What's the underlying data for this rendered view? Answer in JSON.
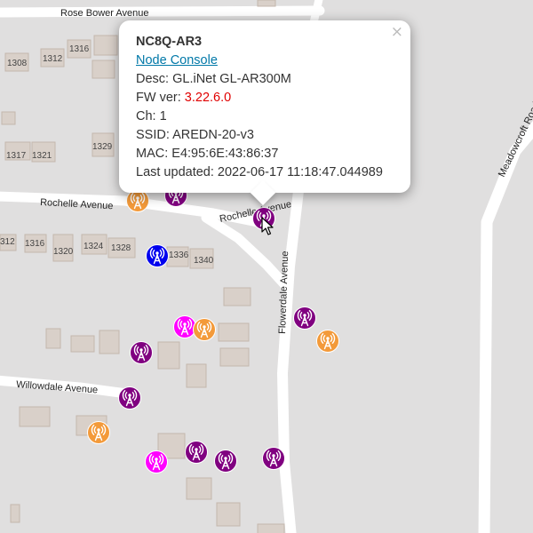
{
  "map": {
    "streets": [
      {
        "name": "Rose Bower Avenue"
      },
      {
        "name": "Rochelle Avenue"
      },
      {
        "name": "Rochelle Avenue"
      },
      {
        "name": "Willowdale Avenue"
      },
      {
        "name": "Flowerdale Avenue"
      },
      {
        "name": "Meadowcroft Road"
      }
    ],
    "house_numbers": [
      "1316",
      "1308",
      "1312",
      "1329",
      "1317",
      "1321",
      "312",
      "1316",
      "1320",
      "1324",
      "1328",
      "1336",
      "1340"
    ],
    "marker_colors": {
      "purple": "#800080",
      "orange": "#f39a3a",
      "magenta": "#ff00ff",
      "blue": "#0000ee"
    },
    "marker_icon": "radio-tower-icon"
  },
  "popup": {
    "node_name": "NC8Q-AR3",
    "console_link": "Node Console",
    "desc_label": "Desc:",
    "desc_value": "GL.iNet GL-AR300M",
    "fw_label": "FW ver:",
    "fw_value": "3.22.6.0",
    "ch_label": "Ch:",
    "ch_value": "1",
    "ssid_label": "SSID:",
    "ssid_value": "AREDN-20-v3",
    "mac_label": "MAC:",
    "mac_value": "E4:95:6E:43:86:37",
    "updated_label": "Last updated:",
    "updated_value": "2022-06-17 11:18:47.044989",
    "close_glyph": "×"
  }
}
